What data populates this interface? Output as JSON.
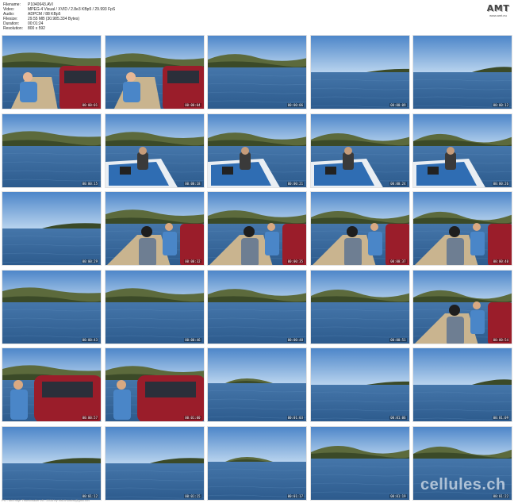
{
  "header": {
    "rows": [
      {
        "label": "Filename:",
        "value": "P1040643.AVI"
      },
      {
        "label": "Video:",
        "value": "MPEG-4 Visual / XVID / 2.8e3 KBp5 / 29.993 FpS"
      },
      {
        "label": "Audio:",
        "value": "ADPCM / 88 KBp5"
      },
      {
        "label": "Filesize:",
        "value": "29.55 MB (30.985.334 Bytes)"
      },
      {
        "label": "Duration:",
        "value": "00:01:24"
      },
      {
        "label": "Resolution:",
        "value": "800 x 592"
      }
    ],
    "logo": {
      "word": "AMT",
      "sub": "www.amt.eu"
    }
  },
  "thumbnails": [
    {
      "time": "00:00:01",
      "scene": "pier"
    },
    {
      "time": "00:00:04",
      "scene": "pier"
    },
    {
      "time": "00:00:06",
      "scene": "lake-hills"
    },
    {
      "time": "00:00:09",
      "scene": "lake-open"
    },
    {
      "time": "00:00:12",
      "scene": "lake-far"
    },
    {
      "time": "00:00:15",
      "scene": "lake-hills"
    },
    {
      "time": "00:00:18",
      "scene": "boat"
    },
    {
      "time": "00:00:21",
      "scene": "boat"
    },
    {
      "time": "00:00:24",
      "scene": "boat"
    },
    {
      "time": "00:00:26",
      "scene": "boat"
    },
    {
      "time": "00:00:29",
      "scene": "lake-far"
    },
    {
      "time": "00:00:32",
      "scene": "people"
    },
    {
      "time": "00:00:35",
      "scene": "people"
    },
    {
      "time": "00:00:37",
      "scene": "people"
    },
    {
      "time": "00:00:40",
      "scene": "people"
    },
    {
      "time": "00:00:43",
      "scene": "lake-hills"
    },
    {
      "time": "00:00:46",
      "scene": "lake-hills"
    },
    {
      "time": "00:00:48",
      "scene": "lake-hills"
    },
    {
      "time": "00:00:51",
      "scene": "lake-hills"
    },
    {
      "time": "00:00:54",
      "scene": "people"
    },
    {
      "time": "00:00:57",
      "scene": "car"
    },
    {
      "time": "00:01:00",
      "scene": "car"
    },
    {
      "time": "00:01:03",
      "scene": "lake-island"
    },
    {
      "time": "00:01:06",
      "scene": "lake-open"
    },
    {
      "time": "00:01:09",
      "scene": "lake-far"
    },
    {
      "time": "00:01:12",
      "scene": "lake-far"
    },
    {
      "time": "00:01:15",
      "scene": "lake-far"
    },
    {
      "time": "00:01:17",
      "scene": "lake-island"
    },
    {
      "time": "00:01:19",
      "scene": "lake-hills"
    },
    {
      "time": "00:01:22",
      "scene": "lake-hills"
    }
  ],
  "watermark": "cellules.ch",
  "footer": "PS - Info hoje Thumbnailer v5 - 2016 by info.thumbs@gmx.net",
  "colors": {
    "sky": "#4d86c9",
    "sky_light": "#b8d3ee",
    "water": "#2c5a8c",
    "water_light": "#4576aa",
    "hill": "#5c6a3c",
    "hill_dark": "#3b4a28",
    "deck": "#c9b48f",
    "car": "#9a1d2a",
    "shirt": "#4a86c8"
  }
}
